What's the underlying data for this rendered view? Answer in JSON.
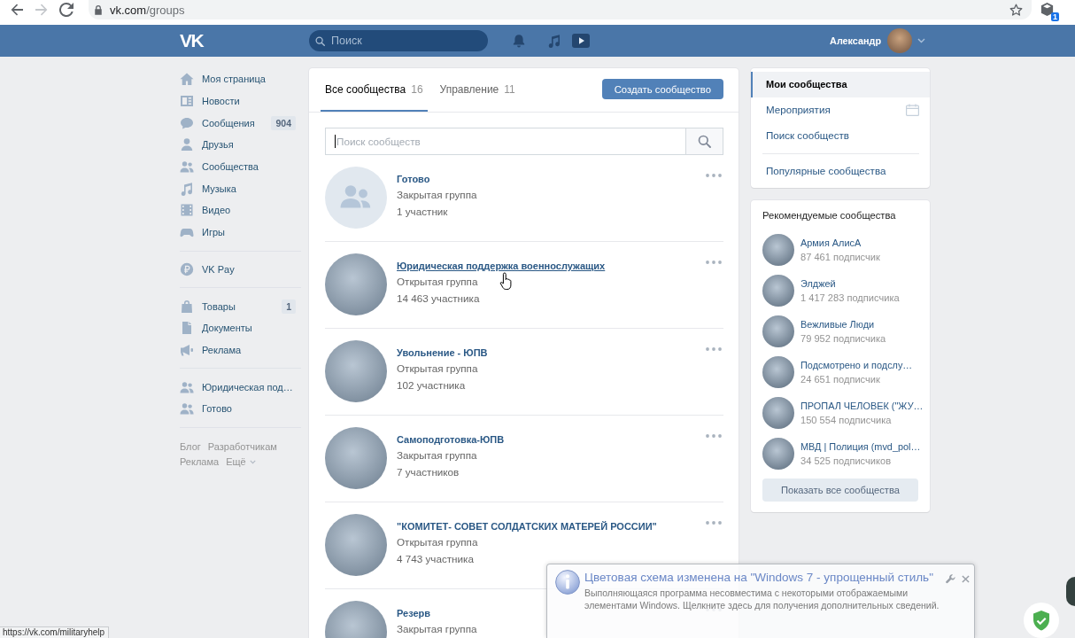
{
  "browser": {
    "url_host": "vk.com",
    "url_path": "/groups",
    "forward_disabled": true,
    "extension_badge": "1",
    "status_url": "https://vk.com/militaryhelp"
  },
  "header": {
    "logo": "VK",
    "search": {
      "placeholder": "Поиск"
    },
    "user_name": "Александр"
  },
  "sidebar": {
    "sections": [
      {
        "items": [
          {
            "label": "Моя страница"
          },
          {
            "label": "Новости"
          },
          {
            "label": "Сообщения",
            "counter": "904"
          },
          {
            "label": "Друзья"
          },
          {
            "label": "Сообщества"
          },
          {
            "label": "Музыка"
          },
          {
            "label": "Видео"
          },
          {
            "label": "Игры"
          }
        ]
      },
      {
        "items": [
          {
            "label": "VK Pay"
          }
        ]
      },
      {
        "items": [
          {
            "label": "Товары",
            "counter": "1"
          },
          {
            "label": "Документы"
          },
          {
            "label": "Реклама"
          }
        ]
      },
      {
        "items": [
          {
            "label": "Юридическая под…"
          },
          {
            "label": "Готово"
          }
        ]
      }
    ],
    "footer_links": [
      "Блог",
      "Разработчикам",
      "Реклама",
      "Ещё"
    ]
  },
  "main": {
    "tabs": [
      {
        "label": "Все сообщества",
        "count": "16",
        "selected": true
      },
      {
        "label": "Управление",
        "count": "11",
        "selected": false
      }
    ],
    "create_button": "Создать сообщество",
    "search": {
      "placeholder": "Поиск сообществ",
      "focused": true
    },
    "groups": [
      {
        "kind": "default",
        "name": "Готово",
        "type": "Закрытая группа",
        "members": "1 участник",
        "hovered": false
      },
      {
        "kind": "photo",
        "name": "Юридическая поддержка военнослужащих",
        "type": "Открытая группа",
        "members": "14 463 участника",
        "hovered": true
      },
      {
        "kind": "photo",
        "name": "Увольнение - ЮПВ",
        "type": "Открытая группа",
        "members": "102 участника",
        "hovered": false
      },
      {
        "kind": "photo",
        "name": "Самоподготовка-ЮПВ",
        "type": "Закрытая группа",
        "members": "7 участников",
        "hovered": false
      },
      {
        "kind": "photo",
        "name": "\"КОМИТЕТ- СОВЕТ СОЛДАТСКИХ МАТЕРЕЙ РОССИИ\"",
        "type": "Открытая группа",
        "members": "4 743 участника",
        "hovered": false
      },
      {
        "kind": "photo",
        "name": "Резерв",
        "type": "Закрытая группа",
        "hovered": false
      }
    ]
  },
  "right_menu": {
    "items": [
      {
        "label": "Мои сообщества",
        "selected": true
      },
      {
        "label": "Мероприятия",
        "selected": false
      },
      {
        "label": "Поиск сообществ",
        "selected": false
      }
    ],
    "extra_items": [
      {
        "label": "Популярные сообщества",
        "selected": false
      }
    ]
  },
  "recommended": {
    "title": "Рекомендуемые сообщества",
    "items": [
      {
        "name": "Армия АлисА",
        "subscribers": "87 461 подписчик"
      },
      {
        "name": "Элджей",
        "subscribers": "1 417 283 подписчика"
      },
      {
        "name": "Вежливые Люди",
        "subscribers": "79 952 подписчика"
      },
      {
        "name": "Подсмотрено и подслу…",
        "subscribers": "24 651 подписчик"
      },
      {
        "name": "ПРОПАЛ ЧЕЛОВЕК (\"ЖУ…",
        "subscribers": "150 554 подписчика"
      },
      {
        "name": "МВД | Полиция (mvd_pol…",
        "subscribers": "34 525 подписчиков"
      }
    ],
    "button": "Показать все сообщества"
  },
  "notification": {
    "title": "Цветовая схема изменена на \"Windows 7 - упрощенный стиль\"",
    "message": "Выполняющаяся программа несовместима с некоторыми отображаемыми элементами Windows. Щелкните здесь для получения дополнительных сведений."
  }
}
